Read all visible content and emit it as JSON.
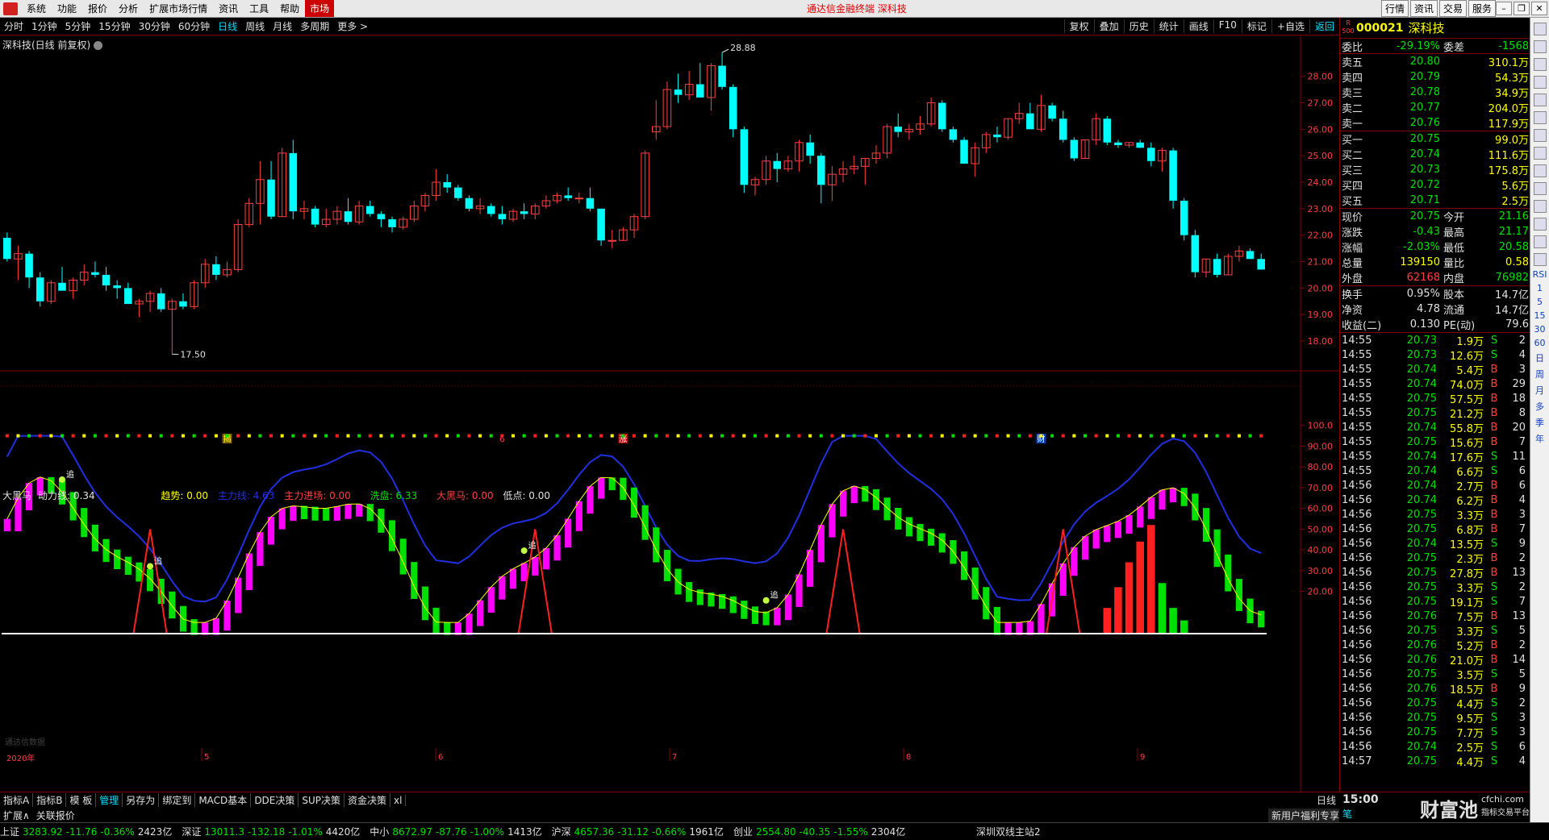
{
  "menubar": {
    "items": [
      "系统",
      "功能",
      "报价",
      "分析",
      "扩展市场行情",
      "资讯",
      "工具",
      "帮助"
    ],
    "market": "市场",
    "title": "通达信金融终端 深科技",
    "right_buttons": [
      "行情",
      "资讯",
      "交易",
      "服务"
    ]
  },
  "periodbar": {
    "periods": [
      "分时",
      "1分钟",
      "5分钟",
      "15分钟",
      "30分钟",
      "60分钟",
      "日线",
      "周线",
      "月线",
      "多周期",
      "更多 >"
    ],
    "active": "日线",
    "tools": [
      "复权",
      "叠加",
      "历史",
      "统计",
      "画线",
      "F10",
      "标记",
      "+自选",
      "返回"
    ]
  },
  "main": {
    "label": "深科技(日线 前复权)",
    "annot_high": "28.88",
    "annot_low": "17.50",
    "markers": [
      {
        "text": "揭",
        "color": "#ffff00",
        "bg": "#806000",
        "idx": 20
      },
      {
        "text": "6",
        "color": "#ff4040",
        "bg": "",
        "idx": 45
      },
      {
        "text": "涨",
        "color": "#ffffff",
        "bg": "#c00000",
        "idx": 56
      },
      {
        "text": "财",
        "color": "#ffffff",
        "bg": "#0040c0",
        "idx": 94
      }
    ],
    "price_axis": [
      "28.00",
      "27.00",
      "26.00",
      "25.00",
      "24.00",
      "23.00",
      "22.00",
      "21.00",
      "20.00",
      "19.00",
      "18.00"
    ]
  },
  "indicator": {
    "name": "大黑马",
    "dongli": "动力线: 0.34",
    "qushi": "趋势: 0.00",
    "zhulixian": "主力线: 4.63",
    "zhulijinchang": "主力进场: 0.00",
    "xipan": "洗盘: 6.33",
    "daheima": "大黑马: 0.00",
    "didian": "低点: 0.00",
    "axis": [
      "100.0",
      "90.00",
      "80.00",
      "70.00",
      "60.00",
      "50.00",
      "40.00",
      "30.00",
      "20.00"
    ],
    "chase_labels": [
      "追",
      "追",
      "追",
      "追"
    ],
    "year_label": "2020年",
    "month_labels": [
      "5",
      "6",
      "7",
      "8",
      "9"
    ],
    "watermark": "通达信数据"
  },
  "chart_data": {
    "type": "candlestick",
    "title": "深科技(日线 前复权)",
    "ylim": [
      17.3,
      29.3
    ],
    "ohlc": [
      [
        21.9,
        22.1,
        21.0,
        21.1
      ],
      [
        21.1,
        21.6,
        20.3,
        21.3
      ],
      [
        21.3,
        21.4,
        20.0,
        20.4
      ],
      [
        20.4,
        20.6,
        19.3,
        19.5
      ],
      [
        19.5,
        20.3,
        19.4,
        20.2
      ],
      [
        20.2,
        20.8,
        19.9,
        19.9
      ],
      [
        19.9,
        20.4,
        19.6,
        20.3
      ],
      [
        20.3,
        20.9,
        20.1,
        20.6
      ],
      [
        20.6,
        21.0,
        20.4,
        20.5
      ],
      [
        20.5,
        20.8,
        19.9,
        20.1
      ],
      [
        20.1,
        20.3,
        19.6,
        20.0
      ],
      [
        20.0,
        20.2,
        19.4,
        19.4
      ],
      [
        19.4,
        19.6,
        18.9,
        19.5
      ],
      [
        19.5,
        19.9,
        19.1,
        19.8
      ],
      [
        19.8,
        20.0,
        19.1,
        19.2
      ],
      [
        19.2,
        19.6,
        17.5,
        19.5
      ],
      [
        19.5,
        19.8,
        19.2,
        19.3
      ],
      [
        19.3,
        20.3,
        19.2,
        20.2
      ],
      [
        20.2,
        21.1,
        20.0,
        20.9
      ],
      [
        20.9,
        21.2,
        20.3,
        20.5
      ],
      [
        20.5,
        21.0,
        20.4,
        20.7
      ],
      [
        20.7,
        22.6,
        20.6,
        22.4
      ],
      [
        22.4,
        23.4,
        22.3,
        23.2
      ],
      [
        23.2,
        24.8,
        22.4,
        24.1
      ],
      [
        24.1,
        24.8,
        22.6,
        22.7
      ],
      [
        22.7,
        25.3,
        22.7,
        25.1
      ],
      [
        25.1,
        25.6,
        22.6,
        22.9
      ],
      [
        22.9,
        23.3,
        22.6,
        23.0
      ],
      [
        23.0,
        23.1,
        22.3,
        22.4
      ],
      [
        22.4,
        23.0,
        22.3,
        22.6
      ],
      [
        22.6,
        23.1,
        22.4,
        22.9
      ],
      [
        22.9,
        23.4,
        22.4,
        22.5
      ],
      [
        22.5,
        23.3,
        22.4,
        23.1
      ],
      [
        23.1,
        23.3,
        22.7,
        22.8
      ],
      [
        22.8,
        22.9,
        22.3,
        22.6
      ],
      [
        22.6,
        22.7,
        22.1,
        22.3
      ],
      [
        22.3,
        22.7,
        22.2,
        22.6
      ],
      [
        22.6,
        23.3,
        22.5,
        23.1
      ],
      [
        23.1,
        23.6,
        22.9,
        23.5
      ],
      [
        23.5,
        24.5,
        23.3,
        24.0
      ],
      [
        24.0,
        24.3,
        23.6,
        23.8
      ],
      [
        23.8,
        23.9,
        23.3,
        23.4
      ],
      [
        23.4,
        23.5,
        22.9,
        23.0
      ],
      [
        23.0,
        23.4,
        22.8,
        23.1
      ],
      [
        23.1,
        23.2,
        22.7,
        22.8
      ],
      [
        22.8,
        23.1,
        22.4,
        22.6
      ],
      [
        22.6,
        23.0,
        22.5,
        22.9
      ],
      [
        22.9,
        23.2,
        22.6,
        22.8
      ],
      [
        22.8,
        23.2,
        22.6,
        23.1
      ],
      [
        23.1,
        23.5,
        23.0,
        23.3
      ],
      [
        23.3,
        23.6,
        23.2,
        23.5
      ],
      [
        23.5,
        23.8,
        23.3,
        23.4
      ],
      [
        23.4,
        23.6,
        23.2,
        23.4
      ],
      [
        23.4,
        23.8,
        22.9,
        23.0
      ],
      [
        23.0,
        23.0,
        21.6,
        21.8
      ],
      [
        21.8,
        22.2,
        21.5,
        21.8
      ],
      [
        21.8,
        22.3,
        21.8,
        22.2
      ],
      [
        22.2,
        22.8,
        21.9,
        22.7
      ],
      [
        22.7,
        25.2,
        22.6,
        25.1
      ],
      [
        25.9,
        27.1,
        25.6,
        26.1
      ],
      [
        26.1,
        27.8,
        26.0,
        27.5
      ],
      [
        27.5,
        28.1,
        27.0,
        27.3
      ],
      [
        27.3,
        28.2,
        27.1,
        27.7
      ],
      [
        27.7,
        28.5,
        27.4,
        27.2
      ],
      [
        27.2,
        28.5,
        26.7,
        28.4
      ],
      [
        28.4,
        28.9,
        27.5,
        27.6
      ],
      [
        27.6,
        27.7,
        25.7,
        26.0
      ],
      [
        26.0,
        26.1,
        23.6,
        23.9
      ],
      [
        23.9,
        24.2,
        23.5,
        24.1
      ],
      [
        24.1,
        25.0,
        23.9,
        24.8
      ],
      [
        24.8,
        25.1,
        24.0,
        24.5
      ],
      [
        24.5,
        25.0,
        24.4,
        24.8
      ],
      [
        24.8,
        25.6,
        24.4,
        25.5
      ],
      [
        25.5,
        25.8,
        24.7,
        25.0
      ],
      [
        25.0,
        25.1,
        23.2,
        23.9
      ],
      [
        23.9,
        24.6,
        23.3,
        24.3
      ],
      [
        24.3,
        24.8,
        24.0,
        24.5
      ],
      [
        24.5,
        25.0,
        24.3,
        24.6
      ],
      [
        24.6,
        24.9,
        23.9,
        24.9
      ],
      [
        24.9,
        25.4,
        24.7,
        25.1
      ],
      [
        25.1,
        26.2,
        24.9,
        26.1
      ],
      [
        26.1,
        26.6,
        25.7,
        25.9
      ],
      [
        25.9,
        26.2,
        25.6,
        26.0
      ],
      [
        26.0,
        26.5,
        25.8,
        26.2
      ],
      [
        26.2,
        27.2,
        26.1,
        27.0
      ],
      [
        27.0,
        27.1,
        25.9,
        26.0
      ],
      [
        26.0,
        26.1,
        25.5,
        25.6
      ],
      [
        25.6,
        25.7,
        24.8,
        24.7
      ],
      [
        24.7,
        25.5,
        24.2,
        25.3
      ],
      [
        25.3,
        25.9,
        25.1,
        25.8
      ],
      [
        25.8,
        26.1,
        25.5,
        25.7
      ],
      [
        25.7,
        26.4,
        25.6,
        26.4
      ],
      [
        26.4,
        27.0,
        26.2,
        26.6
      ],
      [
        26.6,
        27.0,
        26.0,
        26.0
      ],
      [
        26.0,
        27.3,
        25.9,
        26.9
      ],
      [
        26.9,
        27.0,
        26.3,
        26.4
      ],
      [
        26.4,
        26.7,
        25.5,
        25.6
      ],
      [
        25.6,
        25.7,
        24.8,
        24.9
      ],
      [
        24.9,
        25.6,
        24.9,
        25.6
      ],
      [
        25.6,
        26.6,
        25.4,
        26.4
      ],
      [
        26.4,
        26.5,
        25.4,
        25.5
      ],
      [
        25.5,
        25.6,
        25.3,
        25.4
      ],
      [
        25.4,
        25.5,
        25.3,
        25.5
      ],
      [
        25.5,
        25.6,
        25.3,
        25.3
      ],
      [
        25.3,
        25.5,
        24.6,
        24.8
      ],
      [
        24.8,
        25.3,
        24.4,
        25.2
      ],
      [
        25.2,
        25.3,
        23.0,
        23.3
      ],
      [
        23.3,
        23.4,
        21.8,
        22.0
      ],
      [
        22.0,
        22.2,
        20.4,
        20.6
      ],
      [
        20.6,
        21.1,
        20.4,
        21.1
      ],
      [
        21.1,
        21.3,
        20.4,
        20.5
      ],
      [
        20.5,
        21.3,
        20.5,
        21.2
      ],
      [
        21.2,
        21.6,
        21.0,
        21.4
      ],
      [
        21.4,
        21.5,
        21.1,
        21.1
      ],
      [
        21.1,
        21.3,
        20.7,
        20.7
      ]
    ]
  },
  "quote": {
    "code": "000021",
    "name": "深科技",
    "badge": "R 500",
    "weibi": {
      "label": "委比",
      "value": "-29.19%",
      "label2": "委差",
      "value2": "-1568"
    },
    "sell": [
      {
        "label": "卖五",
        "price": "20.80",
        "vol": "310.1万"
      },
      {
        "label": "卖四",
        "price": "20.79",
        "vol": "54.3万"
      },
      {
        "label": "卖三",
        "price": "20.78",
        "vol": "34.9万"
      },
      {
        "label": "卖二",
        "price": "20.77",
        "vol": "204.0万"
      },
      {
        "label": "卖一",
        "price": "20.76",
        "vol": "117.9万"
      }
    ],
    "buy": [
      {
        "label": "买一",
        "price": "20.75",
        "vol": "99.0万"
      },
      {
        "label": "买二",
        "price": "20.74",
        "vol": "111.6万"
      },
      {
        "label": "买三",
        "price": "20.73",
        "vol": "175.8万"
      },
      {
        "label": "买四",
        "price": "20.72",
        "vol": "5.6万"
      },
      {
        "label": "买五",
        "price": "20.71",
        "vol": "2.5万"
      }
    ],
    "stats": [
      {
        "l": "现价",
        "v": "20.75",
        "vc": "c-g",
        "l2": "今开",
        "v2": "21.16",
        "v2c": "c-g"
      },
      {
        "l": "涨跌",
        "v": "-0.43",
        "vc": "c-g",
        "l2": "最高",
        "v2": "21.17",
        "v2c": "c-g"
      },
      {
        "l": "涨幅",
        "v": "-2.03%",
        "vc": "c-g",
        "l2": "最低",
        "v2": "20.58",
        "v2c": "c-g"
      },
      {
        "l": "总量",
        "v": "139150",
        "vc": "c-y",
        "l2": "量比",
        "v2": "0.58",
        "v2c": "c-y"
      },
      {
        "l": "外盘",
        "v": "62168",
        "vc": "c-r",
        "l2": "内盘",
        "v2": "76982",
        "v2c": "c-g"
      }
    ],
    "fund": [
      {
        "l": "换手",
        "v": "0.95%",
        "l2": "股本",
        "v2": "14.7亿"
      },
      {
        "l": "净资",
        "v": "4.78",
        "l2": "流通",
        "v2": "14.7亿"
      },
      {
        "l": "收益(二)",
        "v": "0.130",
        "l2": "PE(动)",
        "v2": "79.6"
      }
    ],
    "ticks": [
      [
        "14:55",
        "20.73",
        "1.9万",
        "S",
        "2"
      ],
      [
        "14:55",
        "20.73",
        "12.6万",
        "S",
        "4"
      ],
      [
        "14:55",
        "20.74",
        "5.4万",
        "B",
        "3"
      ],
      [
        "14:55",
        "20.74",
        "74.0万",
        "B",
        "29"
      ],
      [
        "14:55",
        "20.75",
        "57.5万",
        "B",
        "18"
      ],
      [
        "14:55",
        "20.75",
        "21.2万",
        "B",
        "8"
      ],
      [
        "14:55",
        "20.74",
        "55.8万",
        "B",
        "20"
      ],
      [
        "14:55",
        "20.75",
        "15.6万",
        "B",
        "7"
      ],
      [
        "14:55",
        "20.74",
        "17.6万",
        "S",
        "11"
      ],
      [
        "14:55",
        "20.74",
        "6.6万",
        "S",
        "6"
      ],
      [
        "14:56",
        "20.74",
        "2.7万",
        "B",
        "6"
      ],
      [
        "14:56",
        "20.74",
        "6.2万",
        "B",
        "4"
      ],
      [
        "14:56",
        "20.75",
        "3.3万",
        "B",
        "3"
      ],
      [
        "14:56",
        "20.75",
        "6.8万",
        "B",
        "7"
      ],
      [
        "14:56",
        "20.74",
        "13.5万",
        "S",
        "9"
      ],
      [
        "14:56",
        "20.75",
        "2.3万",
        "B",
        "2"
      ],
      [
        "14:56",
        "20.75",
        "27.8万",
        "B",
        "13"
      ],
      [
        "14:56",
        "20.75",
        "3.3万",
        "S",
        "2"
      ],
      [
        "14:56",
        "20.75",
        "19.1万",
        "S",
        "7"
      ],
      [
        "14:56",
        "20.76",
        "7.5万",
        "B",
        "13"
      ],
      [
        "14:56",
        "20.75",
        "3.3万",
        "S",
        "5"
      ],
      [
        "14:56",
        "20.76",
        "5.2万",
        "B",
        "2"
      ],
      [
        "14:56",
        "20.76",
        "21.0万",
        "B",
        "14"
      ],
      [
        "14:56",
        "20.75",
        "3.5万",
        "S",
        "5"
      ],
      [
        "14:56",
        "20.76",
        "18.5万",
        "B",
        "9"
      ],
      [
        "14:56",
        "20.75",
        "4.4万",
        "S",
        "2"
      ],
      [
        "14:56",
        "20.75",
        "9.5万",
        "S",
        "3"
      ],
      [
        "14:56",
        "20.75",
        "7.7万",
        "S",
        "3"
      ],
      [
        "14:56",
        "20.74",
        "2.5万",
        "S",
        "6"
      ],
      [
        "14:57",
        "20.75",
        "4.4万",
        "S",
        "4"
      ]
    ],
    "bottom_time": "15:00",
    "bottom_tab": "笔"
  },
  "tabbar": {
    "tabs": [
      "指标A",
      "指标B",
      "模 板",
      "管理",
      "另存为",
      "绑定到",
      "MACD基本",
      "DDE决策",
      "SUP决策",
      "资金决策",
      "xl"
    ],
    "active": "管理",
    "period": "日线"
  },
  "tabbar2": {
    "items": [
      "扩展∧",
      "关联报价"
    ],
    "promo": "新用户福利专享"
  },
  "statusbar": {
    "indices": [
      {
        "name": "上证",
        "price": "3283.92",
        "chg": "-11.76",
        "pct": "-0.36%",
        "amt": "2423亿"
      },
      {
        "name": "深证",
        "price": "13011.3",
        "chg": "-132.18",
        "pct": "-1.01%",
        "amt": "4420亿"
      },
      {
        "name": "中小",
        "price": "8672.97",
        "chg": "-87.76",
        "pct": "-1.00%",
        "amt": "1413亿"
      },
      {
        "name": "沪深",
        "price": "4657.36",
        "chg": "-31.12",
        "pct": "-0.66%",
        "amt": "1961亿"
      },
      {
        "name": "创业",
        "price": "2554.80",
        "chg": "-40.35",
        "pct": "-1.55%",
        "amt": "2304亿"
      }
    ],
    "station": "深圳双线主站2"
  },
  "watermark": {
    "big": "财富池",
    "site": "cfchi.com",
    "sub": "指标交易平台"
  },
  "side_icons": [
    "RSI",
    "1",
    "5",
    "15",
    "30",
    "60",
    "日",
    "周",
    "月",
    "多",
    "季",
    "年"
  ],
  "colors": {
    "up": "#ff4040",
    "down": "#00ffff",
    "green": "#00e000",
    "magenta": "#ff00ff",
    "blue": "#2030e0"
  }
}
